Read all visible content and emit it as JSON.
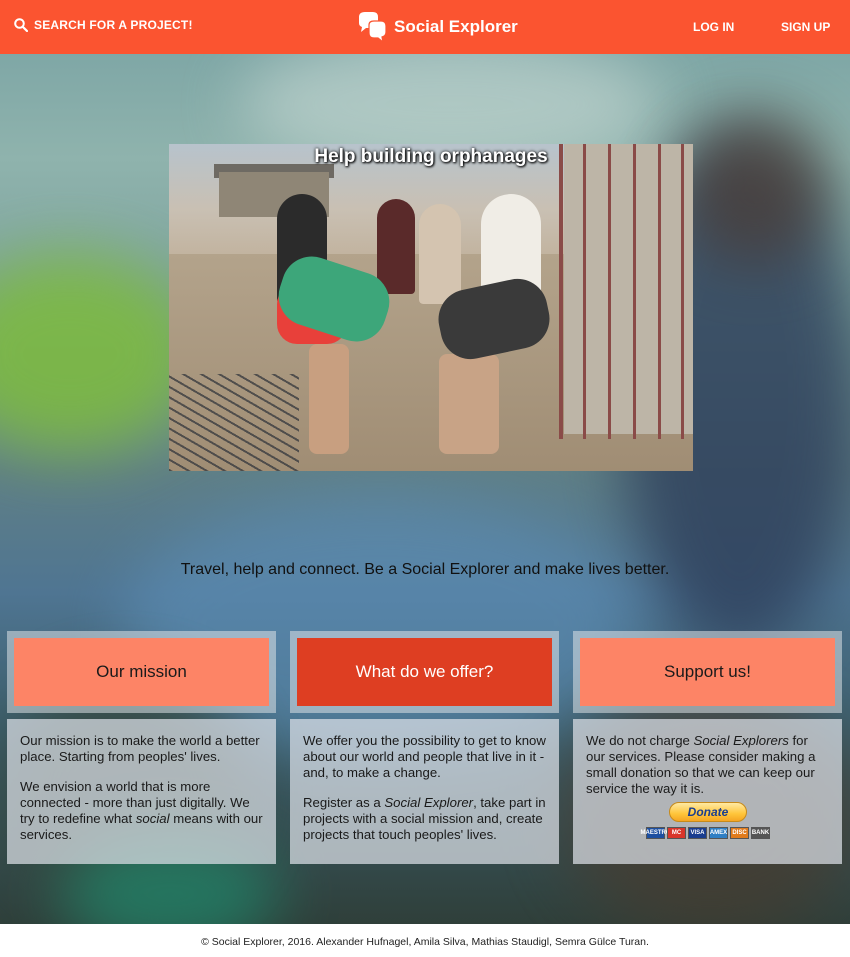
{
  "header": {
    "search_label": "SEARCH FOR A PROJECT!",
    "brand": "Social Explorer",
    "login_label": "LOG IN",
    "signup_label": "SIGN UP",
    "color": "#fb5430"
  },
  "hero": {
    "title": "Help building orphanages"
  },
  "tagline": "Travel, help and connect. Be a Social Explorer and make lives better.",
  "cards": [
    {
      "title": "Our mission",
      "paragraph_1": "Our mission is to make the world a better place. Starting from peoples' lives.",
      "paragraph_2_prefix": "We envision a world that is more connected - more than just digitally. We try to redefine what ",
      "paragraph_2_em": "social",
      "paragraph_2_suffix": " means with our services."
    },
    {
      "title": "What do we offer?",
      "paragraph_1": "We offer you the possibility to get to know about our world and people that live in it - and, to make a change.",
      "paragraph_2_prefix": "Register as a ",
      "paragraph_2_em": "Social Explorer",
      "paragraph_2_suffix": ", take part in projects with a social mission and, create projects that touch peoples' lives."
    },
    {
      "title": "Support us!",
      "paragraph_1_prefix": "We do not charge ",
      "paragraph_1_em": "Social Explorers",
      "paragraph_1_suffix": " for our services. Please consider making a small donation so that we can keep our service the way it is.",
      "donate_label": "Donate",
      "card_logos": [
        "MAESTRO",
        "MC",
        "VISA",
        "AMEX",
        "DISC",
        "BANK"
      ]
    }
  ],
  "footer": "© Social Explorer, 2016. Alexander Hufnagel, Amila Silva, Mathias Staudigl, Semra Gülce Turan."
}
